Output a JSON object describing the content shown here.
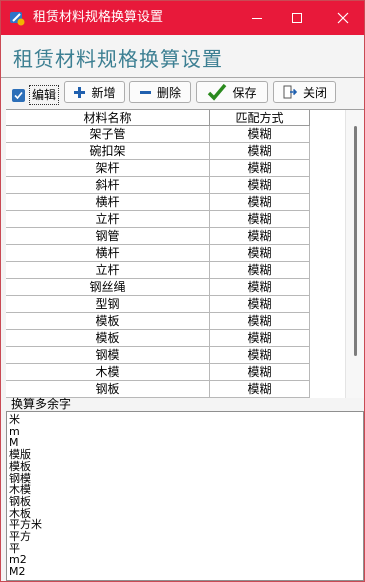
{
  "window": {
    "title": "租赁材料规格换算设置",
    "heading": "租赁材料规格换算设置"
  },
  "colors": {
    "titlebar": "#e8193a",
    "heading": "#3c7f92",
    "accent": "#2d6fb8"
  },
  "toolbar": {
    "edit_checkbox_label": "编辑",
    "edit_checked": true,
    "add_label": "新增",
    "delete_label": "删除",
    "save_label": "保存",
    "close_label": "关闭"
  },
  "grid": {
    "columns": [
      "材料名称",
      "匹配方式"
    ],
    "rows": [
      [
        "架子管",
        "模糊"
      ],
      [
        "碗扣架",
        "模糊"
      ],
      [
        "架杆",
        "模糊"
      ],
      [
        "斜杆",
        "模糊"
      ],
      [
        "横杆",
        "模糊"
      ],
      [
        "立杆",
        "模糊"
      ],
      [
        "钢管",
        "模糊"
      ],
      [
        "横杆",
        "模糊"
      ],
      [
        "立杆",
        "模糊"
      ],
      [
        "钢丝绳",
        "模糊"
      ],
      [
        "型钢",
        "模糊"
      ],
      [
        "模板",
        "模糊"
      ],
      [
        "模板",
        "模糊"
      ],
      [
        "钢模",
        "模糊"
      ],
      [
        "木模",
        "模糊"
      ],
      [
        "钢板",
        "模糊"
      ]
    ]
  },
  "extra_chars": {
    "title": "换算多余字",
    "lines": [
      "米",
      "m",
      "M",
      "模版",
      "模板",
      "钢模",
      "木模",
      "钢板",
      "木板",
      "平方米",
      "平方",
      "平",
      "m2",
      "M2"
    ]
  }
}
